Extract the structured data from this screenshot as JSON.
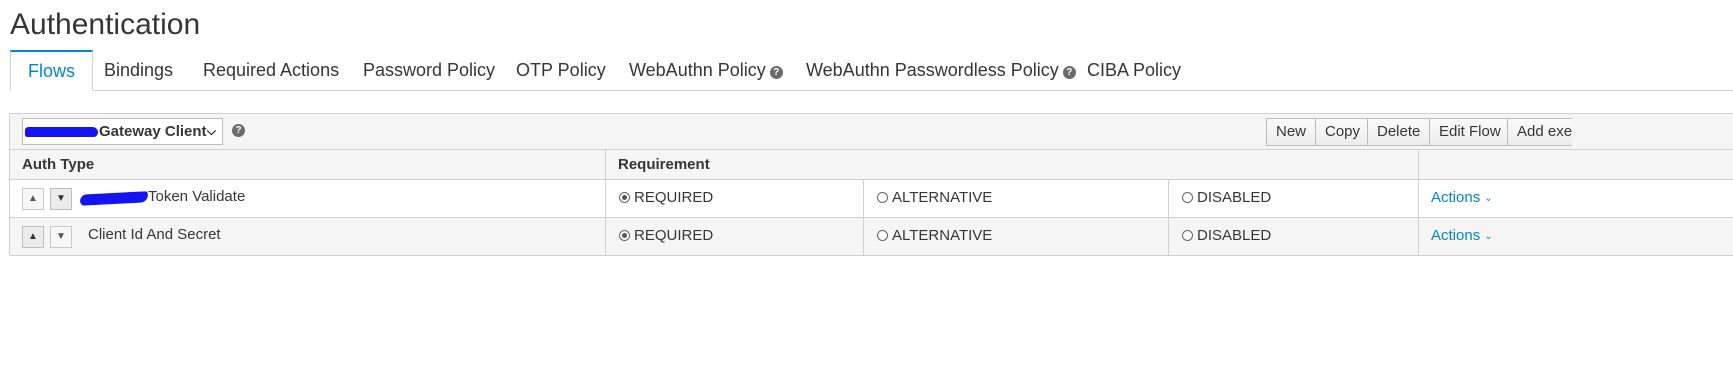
{
  "page": {
    "title": "Authentication"
  },
  "tabs": [
    {
      "label": "Flows",
      "active": true
    },
    {
      "label": "Bindings"
    },
    {
      "label": "Required Actions"
    },
    {
      "label": "Password Policy"
    },
    {
      "label": "OTP Policy"
    },
    {
      "label": "WebAuthn Policy",
      "help": true
    },
    {
      "label": "WebAuthn Passwordless Policy",
      "help": true
    },
    {
      "label": "CIBA Policy"
    }
  ],
  "toolbar": {
    "flow_select_value": "Gateway Client",
    "buttons": {
      "new": "New",
      "copy": "Copy",
      "delete": "Delete",
      "edit_flow": "Edit Flow",
      "add_execution": "Add exe"
    }
  },
  "table": {
    "headers": {
      "auth_type": "Auth Type",
      "requirement": "Requirement"
    },
    "rows": [
      {
        "auth_type": "Token Validate",
        "requirement": "REQUIRED",
        "options": [
          "REQUIRED",
          "ALTERNATIVE",
          "DISABLED"
        ],
        "actions": "Actions"
      },
      {
        "auth_type": "Client Id And Secret",
        "requirement": "REQUIRED",
        "options": [
          "REQUIRED",
          "ALTERNATIVE",
          "DISABLED"
        ],
        "actions": "Actions"
      }
    ]
  },
  "icons": {
    "help": "question-circle-icon",
    "chevron": "chevron-down-icon",
    "up": "caret-up-icon",
    "down": "caret-down-icon"
  },
  "colors": {
    "link": "#0088ce",
    "tab_active": "#0088ce",
    "redaction": "#1414f0"
  }
}
